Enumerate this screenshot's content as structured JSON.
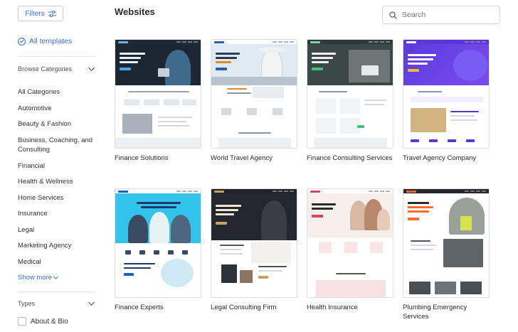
{
  "sidebar": {
    "filters_label": "Filters",
    "all_templates_label": "All templates",
    "browse_categories_label": "Browse Categories",
    "categories": [
      "All Categories",
      "Automotive",
      "Beauty & Fashion",
      "Business, Coaching, and Consulting",
      "Financial",
      "Health & Wellness",
      "Home Services",
      "Insurance",
      "Legal",
      "Marketing Agency",
      "Medical"
    ],
    "show_more_label": "Show more",
    "types_label": "Types",
    "type_items": [
      "About & Bio"
    ]
  },
  "main": {
    "title": "Websites",
    "search_placeholder": "Search",
    "templates": [
      "Finance Solutions",
      "World Travel Agency",
      "Finance Consulting Services",
      "Travel Agency Company",
      "Finance Experts",
      "Legal Consulting Firm",
      "Health Insurance",
      "Plumbing Emergency Services"
    ]
  },
  "colors": {
    "accent": "#3b6fd8",
    "border": "#dcdfe3"
  }
}
